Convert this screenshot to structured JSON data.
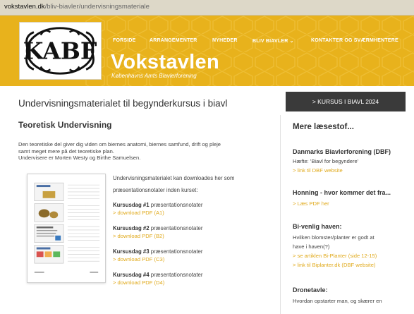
{
  "browser": {
    "url_host": "vokstavlen.dk",
    "url_path": "/bliv-biavler/undervisningsmateriale"
  },
  "header": {
    "logo_letters": "KABF",
    "title": "Vokstavlen",
    "subtitle": "Københavns Amts Biavlerforening",
    "brand_color": "#e8b21c",
    "nav": [
      {
        "label": "FORSIDE"
      },
      {
        "label": "ARRANGEMENTER"
      },
      {
        "label": "NYHEDER"
      },
      {
        "label": "BLIV BIAVLER",
        "icon": "chevron-down-icon"
      },
      {
        "label": "KONTAKTER OG SVÆRMHENTERE"
      }
    ]
  },
  "main": {
    "page_title": "Undervisningsmaterialet til begynderkursus i biavl",
    "section_title": "Teoretisk Undervisning",
    "intro_line1": "Den teoretiske del giver dig viden om biernes anatomi, biernes samfund, drift og pleje",
    "intro_line2": "samt meget mere på det teoretiske plan.",
    "intro_line3": "Undervisere er Morten Westy og Birthe Samuelsen.",
    "download_intro": "Undervisningsmaterialet kan downloades her som præsentationsnotater inden kurset:",
    "courses": [
      {
        "name": "Kursusdag #1",
        "desc": "præsentationsnotater",
        "link": "> download PDF (A1)"
      },
      {
        "name": "Kursusdag #2",
        "desc": "præsentationsnotater",
        "link": "> download PDF (B2)"
      },
      {
        "name": "Kursusdag #3",
        "desc": "præsentationsnotater",
        "link": "> download PDF (C3)"
      },
      {
        "name": "Kursusdag #4",
        "desc": "præsentationsnotater",
        "link": "> download PDF (D4)"
      }
    ]
  },
  "sidebar": {
    "cta": "> KURSUS I BIAVL 2024",
    "heading": "Mere læsestof...",
    "dbf_title": "Danmarks Biavlerforening (DBF)",
    "dbf_text": "Hæfte: 'Biavl for begyndere'",
    "dbf_link": "> link til DBF website",
    "honey_title": "Honning - hvor kommer det fra...",
    "honey_link": "> Læs PDF her",
    "garden_title": "Bi-venlig haven:",
    "garden_text1": "Hvilken blomster/planter er godt at",
    "garden_text2": "have i haven(?)",
    "garden_link1": "> se artiklen Bi-Planter (side 12-15)",
    "garden_link2": "> link til Biplanter.dk (DBF website)",
    "drone_title": "Dronetavle:",
    "drone_text": "Hvordan opstarter man, og skærer en"
  },
  "colors": {
    "link": "#e0a91a",
    "cta_bg": "#3a3a3a"
  }
}
